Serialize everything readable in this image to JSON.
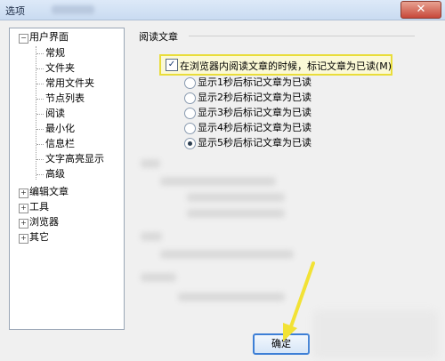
{
  "window": {
    "title": "选项",
    "close_label": "✕"
  },
  "tree": {
    "items": [
      {
        "label": "用户界面",
        "toggle": "⊟"
      },
      {
        "label": "常规"
      },
      {
        "label": "文件夹"
      },
      {
        "label": "常用文件夹"
      },
      {
        "label": "节点列表"
      },
      {
        "label": "阅读"
      },
      {
        "label": "最小化"
      },
      {
        "label": "信息栏"
      },
      {
        "label": "文字高亮显示"
      },
      {
        "label": "高级"
      },
      {
        "label": "编辑文章",
        "toggle": "⊞"
      },
      {
        "label": "工具",
        "toggle": "⊞"
      },
      {
        "label": "浏览器",
        "toggle": "⊞"
      },
      {
        "label": "其它",
        "toggle": "⊞"
      }
    ]
  },
  "reading": {
    "section_title": "阅读文章",
    "checkbox_label": "在浏览器内阅读文章的时候，标记文章为已读(M)",
    "checkbox_checked": "✓",
    "options": [
      {
        "label": "显示1秒后标记文章为已读",
        "selected": false
      },
      {
        "label": "显示2秒后标记文章为已读",
        "selected": false
      },
      {
        "label": "显示3秒后标记文章为已读",
        "selected": false
      },
      {
        "label": "显示4秒后标记文章为已读",
        "selected": false
      },
      {
        "label": "显示5秒后标记文章为已读",
        "selected": true
      }
    ]
  },
  "footer": {
    "ok_label": "确定"
  },
  "colors": {
    "highlight": "#e9dd3a",
    "arrow": "#f2e235",
    "ok_border": "#3d7fd6"
  }
}
